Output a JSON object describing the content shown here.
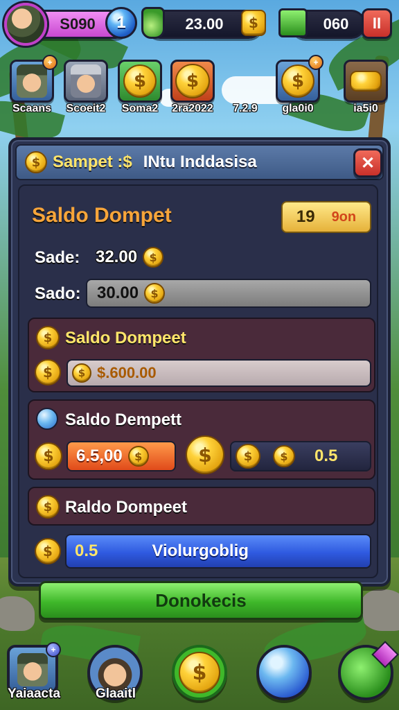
{
  "hud": {
    "level_value": "S090",
    "level_orb": "1",
    "potion_value": "23.00",
    "gems_value": "060",
    "pause_label": "II"
  },
  "shortcuts": [
    {
      "label": "Scaans",
      "icon": "character-icon"
    },
    {
      "label": "Scoeit2",
      "icon": "character-icon"
    },
    {
      "label": "Soma2",
      "icon": "coin-icon"
    },
    {
      "label": "2ra2022",
      "icon": "coin-icon"
    },
    {
      "label": "7.2.9",
      "icon": "empty-icon"
    },
    {
      "label": "gla0i0",
      "icon": "coin-icon"
    },
    {
      "label": "ia5i0",
      "icon": "coin-stack-icon"
    }
  ],
  "panel": {
    "title": "Sampet :$",
    "subtitle": "INtu Inddasisa",
    "close_label": "✕",
    "header": "Saldo Dompet",
    "header_pill_value": "19",
    "header_pill_unit": "9on",
    "row1_label": "Sade:",
    "row1_value": "32.00",
    "row2_label": "Sado:",
    "row2_value": "30.00",
    "card1": {
      "title": "Saldo Dompeet",
      "value": "$.600.00"
    },
    "card2": {
      "title": "Saldo Dempett",
      "value_a": "6.5,00",
      "value_b": "0.5"
    },
    "card3": {
      "title": "Raldo Dompeet",
      "value": "0.5",
      "action": "Violurgoblig"
    }
  },
  "confirm_label": "Donokecis",
  "bottom_nav": [
    {
      "label": "Yaiaacta",
      "icon": "character-icon"
    },
    {
      "label": "Glaaitl",
      "icon": "character-icon"
    },
    {
      "label": "",
      "icon": "coin-icon"
    },
    {
      "label": "",
      "icon": "orb-icon"
    },
    {
      "label": "",
      "icon": "gift-icon"
    }
  ],
  "colors": {
    "accent_yellow": "#ffe56a",
    "panel_bg": "#2b3350",
    "orange_bar": "#f26a2c",
    "blue_bar": "#2f5ae0",
    "green_button": "#3fb82a",
    "close_red": "#c8302a"
  }
}
